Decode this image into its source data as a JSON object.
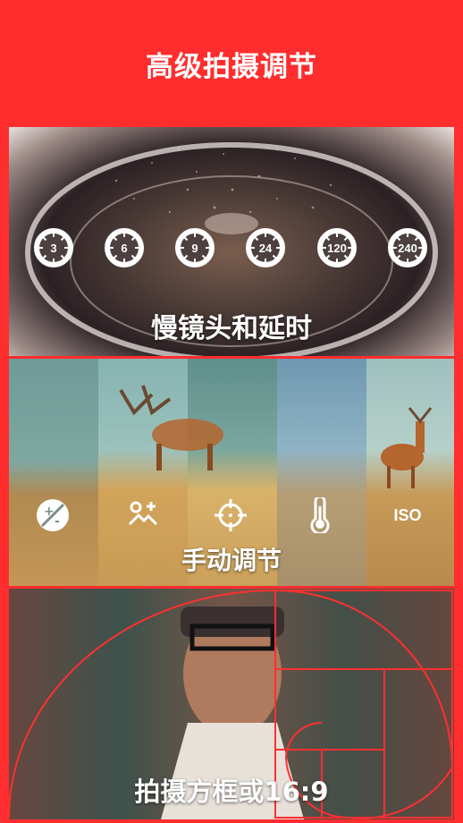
{
  "header": {
    "title": "高级拍摄调节"
  },
  "slow_motion": {
    "speeds": [
      "3",
      "6",
      "9",
      "24",
      "120",
      "240"
    ],
    "caption": "慢镜头和延时"
  },
  "manual": {
    "tools": [
      {
        "icon": "exposure-compensation-icon"
      },
      {
        "icon": "focus-landscape-icon"
      },
      {
        "icon": "crosshair-icon"
      },
      {
        "icon": "thermometer-icon"
      },
      {
        "icon": "iso-icon",
        "label": "ISO"
      }
    ],
    "caption": "手动调节"
  },
  "framing": {
    "caption": "拍摄方框或16:9"
  },
  "colors": {
    "accent": "#FF2D2D"
  }
}
